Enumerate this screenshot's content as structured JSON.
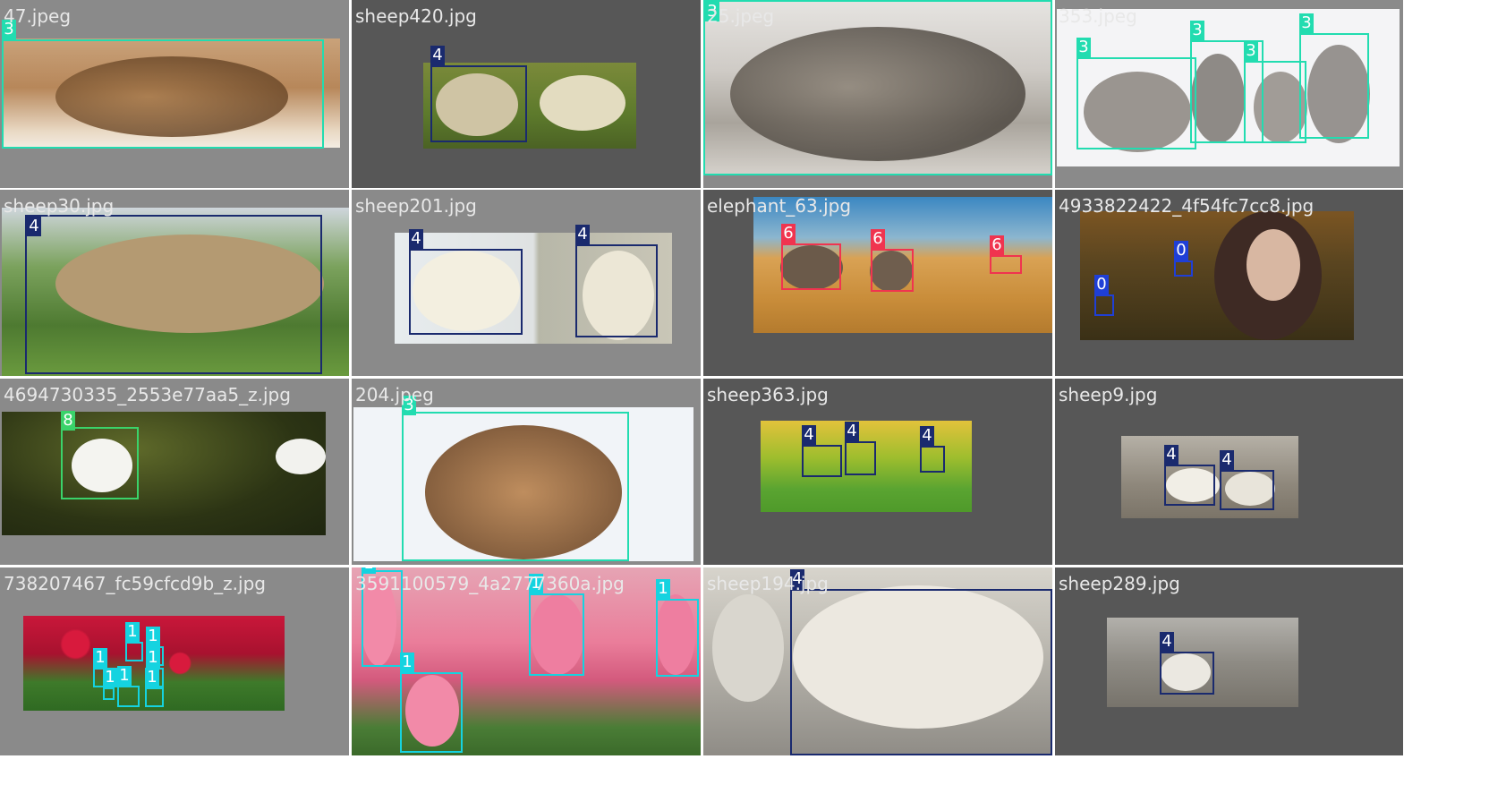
{
  "tiles": [
    {
      "file": "47.jpeg",
      "labels": [
        "3"
      ]
    },
    {
      "file": "sheep420.jpg",
      "labels": [
        "4"
      ]
    },
    {
      "file": "25.jpeg",
      "labels": [
        "3"
      ]
    },
    {
      "file": "353.jpeg",
      "labels": [
        "3",
        "3",
        "3",
        "3"
      ]
    },
    {
      "file": "sheep30.jpg",
      "labels": [
        "4"
      ]
    },
    {
      "file": "sheep201.jpg",
      "labels": [
        "4",
        "4"
      ]
    },
    {
      "file": "elephant_63.jpg",
      "labels": [
        "6",
        "6",
        "6"
      ]
    },
    {
      "file": "4933822422_4f54fc7cc8.jpg",
      "labels": [
        "0",
        "0"
      ]
    },
    {
      "file": "4694730335_2553e77aa5_z.jpg",
      "labels": [
        "8"
      ]
    },
    {
      "file": "204.jpeg",
      "labels": [
        "3"
      ]
    },
    {
      "file": "sheep363.jpg",
      "labels": [
        "4",
        "4",
        "4"
      ]
    },
    {
      "file": "sheep9.jpg",
      "labels": [
        "4",
        "4"
      ]
    },
    {
      "file": "738207467_fc59cfcd9b_z.jpg",
      "labels": [
        "1",
        "1",
        "1",
        "1",
        "1",
        "1",
        "1"
      ]
    },
    {
      "file": "3591100579_4a2777360a.jpg",
      "labels": [
        "1",
        "1",
        "1",
        "1"
      ]
    },
    {
      "file": "sheep194.jpg",
      "labels": [
        "4"
      ]
    },
    {
      "file": "sheep289.jpg",
      "labels": [
        "4"
      ]
    }
  ],
  "colors": {
    "class_0": "#1f3fd6",
    "class_1": "#15d3e0",
    "class_3": "#22dcb0",
    "class_4": "#1a2a6e",
    "class_6": "#f0344f",
    "class_8": "#3ad36a",
    "tile_gray_light": "#8a8a8a",
    "tile_gray_dark": "#575757"
  }
}
